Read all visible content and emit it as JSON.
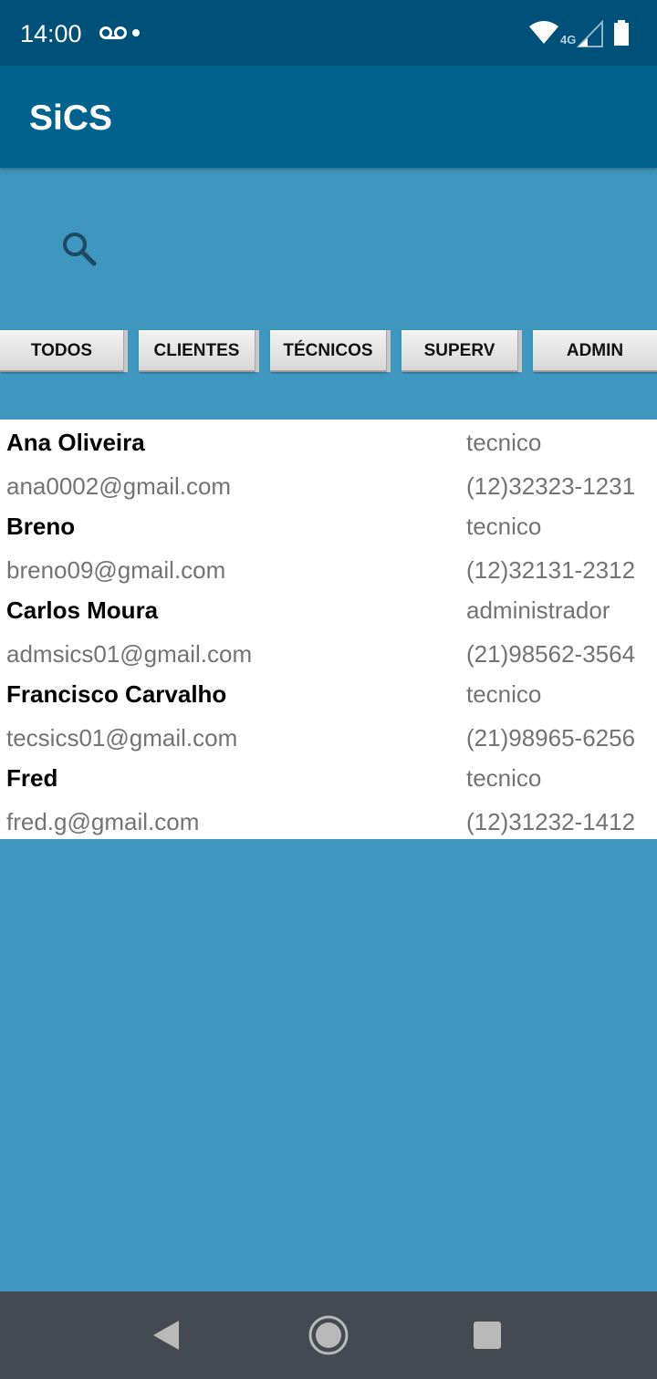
{
  "status_bar": {
    "time": "14:00",
    "network_label": "4G",
    "icons": [
      "voicemail-icon",
      "notification-dot-icon",
      "wifi-icon",
      "cellular-signal-icon",
      "battery-icon"
    ]
  },
  "app_bar": {
    "title": "SiCS"
  },
  "search": {
    "placeholder": "",
    "value": "",
    "icon": "search-icon"
  },
  "filters": [
    "TODOS",
    "CLIENTES",
    "TÉCNICOS",
    "SUPERV",
    "ADMIN"
  ],
  "users": [
    {
      "name": "Ana Oliveira",
      "role": "tecnico",
      "email": "ana0002@gmail.com",
      "phone": "(12)32323-1231"
    },
    {
      "name": "Breno",
      "role": "tecnico",
      "email": "breno09@gmail.com",
      "phone": "(12)32131-2312"
    },
    {
      "name": "Carlos Moura",
      "role": "administrador",
      "email": "admsics01@gmail.com",
      "phone": "(21)98562-3564"
    },
    {
      "name": "Francisco Carvalho",
      "role": "tecnico",
      "email": "tecsics01@gmail.com",
      "phone": "(21)98965-6256"
    },
    {
      "name": "Fred",
      "role": "tecnico",
      "email": "fred.g@gmail.com",
      "phone": "(12)31232-1412"
    }
  ],
  "colors": {
    "status_bar": "#005179",
    "app_bar": "#00638d",
    "background": "#3f96be",
    "nav_bar": "#434a51",
    "secondary_text": "#737373"
  },
  "nav_bar": {
    "buttons": [
      "back-icon",
      "home-icon",
      "recents-icon"
    ]
  }
}
